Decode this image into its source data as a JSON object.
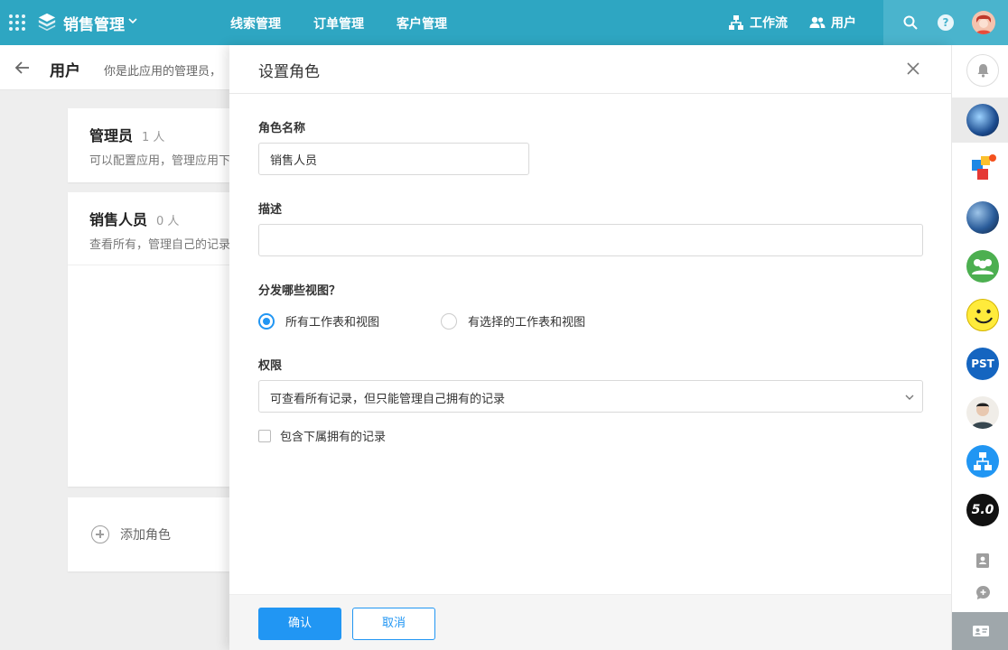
{
  "topbar": {
    "app_title": "销售管理",
    "nav": [
      "线索管理",
      "订单管理",
      "客户管理"
    ],
    "workflow_label": "工作流",
    "users_label": "用户",
    "help_glyph": "?"
  },
  "page": {
    "title": "用户",
    "description": "你是此应用的管理员，",
    "roles": [
      {
        "name": "管理员",
        "count": "1 人",
        "desc": "可以配置应用，管理应用下"
      },
      {
        "name": "销售人员",
        "count": "0 人",
        "desc": "查看所有，管理自己的记录"
      }
    ],
    "add_role_label": "添加角色"
  },
  "drawer": {
    "title": "设置角色",
    "role_name_label": "角色名称",
    "role_name_value": "销售人员",
    "desc_label": "描述",
    "desc_value": "",
    "views_label": "分发哪些视图？",
    "view_options": [
      "所有工作表和视图",
      "有选择的工作表和视图"
    ],
    "view_selected": 0,
    "perm_label": "权限",
    "perm_value": "可查看所有记录，但只能管理自己拥有的记录",
    "include_sub_label": "包含下属拥有的记录",
    "include_sub_checked": false,
    "confirm_label": "确认",
    "cancel_label": "取消"
  },
  "rail": {
    "apps": [
      "app-1",
      "app-2",
      "app-3",
      "app-4",
      "app-5",
      "PST",
      "app-7",
      "app-8",
      "5.0"
    ]
  },
  "colors": {
    "topbar": "#2ea6c2",
    "primary": "#2196f3"
  }
}
